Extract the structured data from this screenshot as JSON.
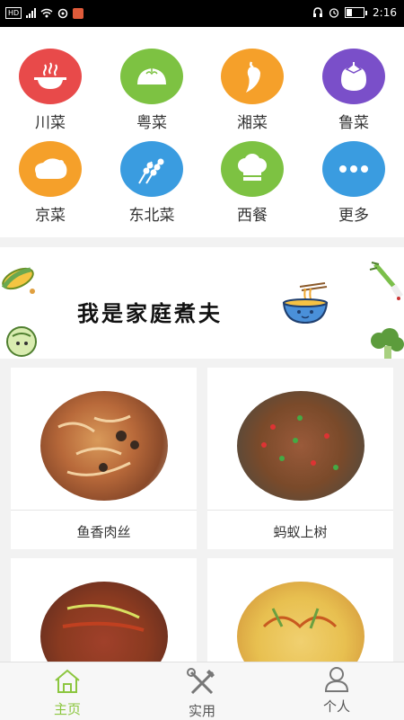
{
  "status_bar": {
    "left_icons": [
      "hd-icon",
      "signal-4g-icon",
      "wifi-icon",
      "sync-icon",
      "app-notification-icon"
    ],
    "hd": "HD",
    "right_icons": [
      "headphones-icon",
      "alarm-icon",
      "battery-icon"
    ],
    "time": "2:16"
  },
  "categories": [
    {
      "label": "川菜",
      "icon": "hot-pot-icon",
      "color": "#e84a4a"
    },
    {
      "label": "粤菜",
      "icon": "dumpling-icon",
      "color": "#7dc242"
    },
    {
      "label": "湘菜",
      "icon": "chili-pepper-icon",
      "color": "#f5a02a"
    },
    {
      "label": "鲁菜",
      "icon": "eggplant-icon",
      "color": "#7a4fc9"
    },
    {
      "label": "京菜",
      "icon": "roast-duck-icon",
      "color": "#f5a02a"
    },
    {
      "label": "东北菜",
      "icon": "skewer-icon",
      "color": "#3a9ce0"
    },
    {
      "label": "西餐",
      "icon": "chef-hat-icon",
      "color": "#7dc242"
    },
    {
      "label": "更多",
      "icon": "more-icon",
      "color": "#3a9ce0"
    }
  ],
  "banner": {
    "title": "我是家庭煮夫"
  },
  "recipes": [
    {
      "name": "鱼香肉丝"
    },
    {
      "name": "蚂蚁上树"
    },
    {
      "name": ""
    },
    {
      "name": ""
    }
  ],
  "tabs": [
    {
      "label": "主页",
      "icon": "home-icon",
      "active": true,
      "color": "#8cc63f"
    },
    {
      "label": "实用",
      "icon": "tools-icon",
      "active": false,
      "color": "#555555"
    },
    {
      "label": "个人",
      "icon": "person-icon",
      "active": false,
      "color": "#555555"
    }
  ]
}
